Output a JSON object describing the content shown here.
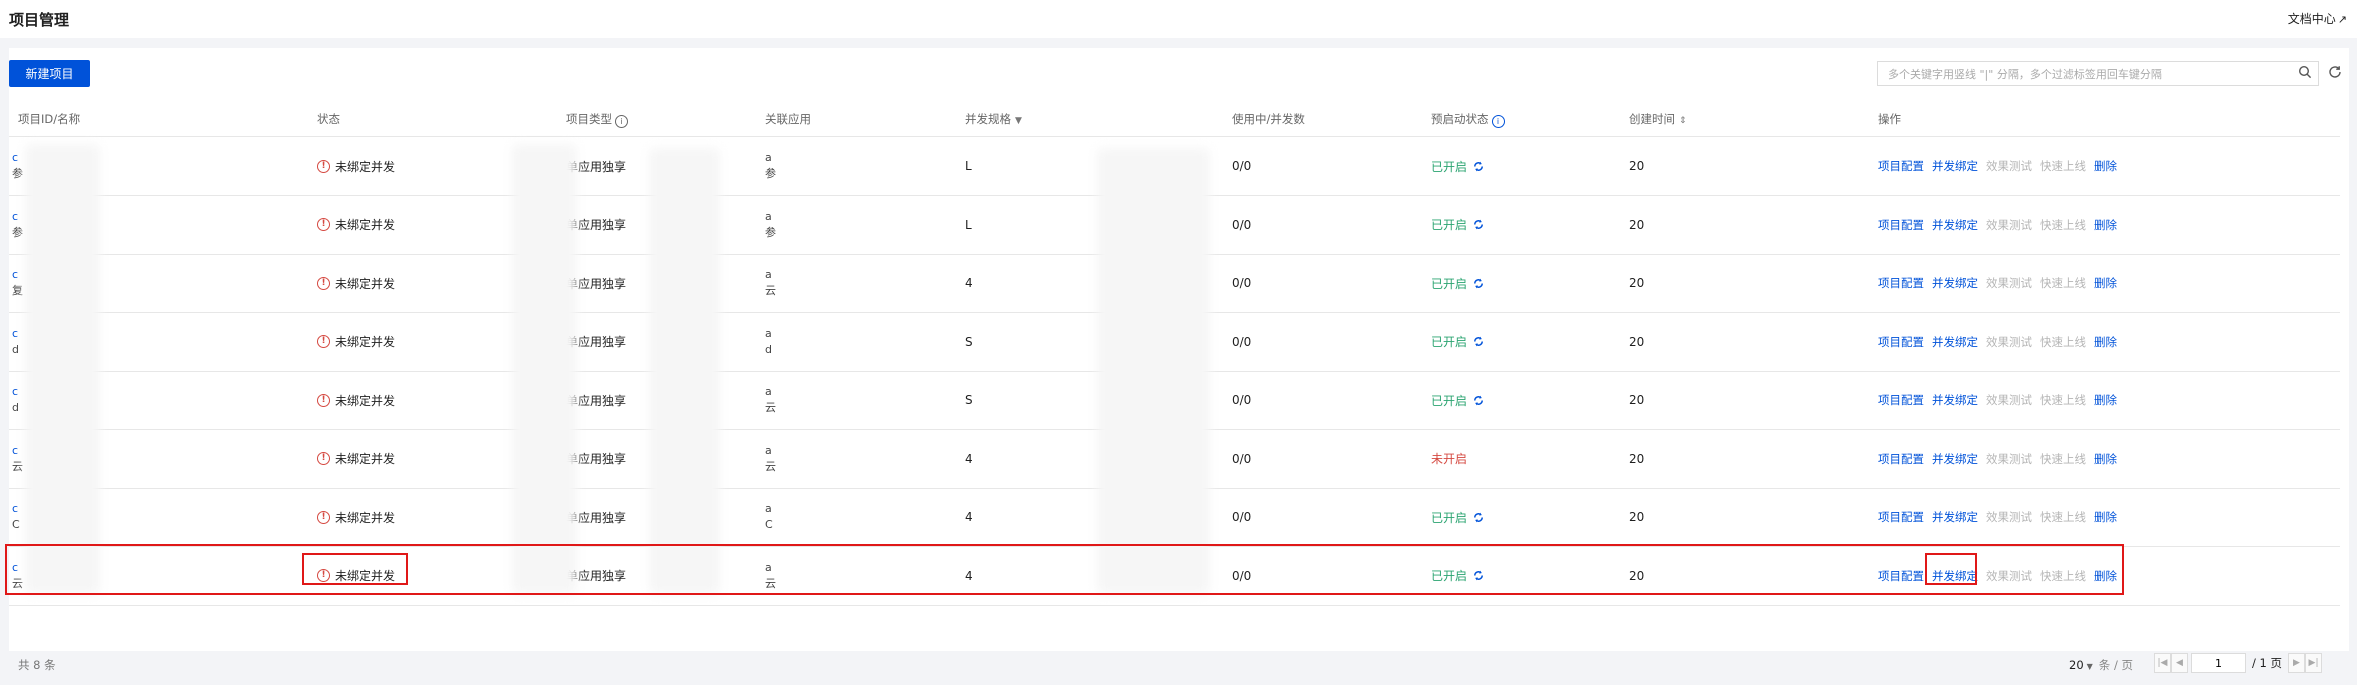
{
  "header": {
    "title": "项目管理",
    "doc_link": "文档中心"
  },
  "toolbar": {
    "new_button": "新建项目",
    "search_placeholder": "多个关键字用竖线 \"|\" 分隔，多个过滤标签用回车键分隔"
  },
  "columns": [
    "项目ID/名称",
    "状态",
    "项目类型",
    "关联应用",
    "并发规格",
    "使用中/并发数",
    "预启动状态",
    "创建时间",
    "操作"
  ],
  "rows": [
    {
      "id": "c",
      "name": "参",
      "status": "未绑定并发",
      "type": "单应用独享",
      "app1": "a",
      "app2": "参",
      "spec": "L",
      "usage": "0/0",
      "prestart": "已开启",
      "prestart_on": true,
      "created": "20"
    },
    {
      "id": "c",
      "name": "参",
      "status": "未绑定并发",
      "type": "单应用独享",
      "app1": "a",
      "app2": "参",
      "spec": "L",
      "usage": "0/0",
      "prestart": "已开启",
      "prestart_on": true,
      "created": "20"
    },
    {
      "id": "c",
      "name": "复",
      "status": "未绑定并发",
      "type": "单应用独享",
      "app1": "a",
      "app2": "云",
      "spec": "4",
      "usage": "0/0",
      "prestart": "已开启",
      "prestart_on": true,
      "created": "20"
    },
    {
      "id": "c",
      "name": "d",
      "status": "未绑定并发",
      "type": "单应用独享",
      "app1": "a",
      "app2": "d",
      "spec": "S",
      "usage": "0/0",
      "prestart": "已开启",
      "prestart_on": true,
      "created": "20"
    },
    {
      "id": "c",
      "name": "d",
      "status": "未绑定并发",
      "type": "单应用独享",
      "app1": "a",
      "app2": "云",
      "spec": "S",
      "usage": "0/0",
      "prestart": "已开启",
      "prestart_on": true,
      "created": "20"
    },
    {
      "id": "c",
      "name": "云",
      "status": "未绑定并发",
      "type": "单应用独享",
      "app1": "a",
      "app2": "云",
      "spec": "4",
      "usage": "0/0",
      "prestart": "未开启",
      "prestart_on": false,
      "created": "20"
    },
    {
      "id": "c",
      "name": "C",
      "status": "未绑定并发",
      "type": "单应用独享",
      "app1": "a",
      "app2": "C",
      "spec": "4",
      "usage": "0/0",
      "prestart": "已开启",
      "prestart_on": true,
      "created": "20"
    },
    {
      "id": "c",
      "name": "云",
      "status": "未绑定并发",
      "type": "单应用独享",
      "app1": "a",
      "app2": "云",
      "spec": "4",
      "usage": "0/0",
      "prestart": "已开启",
      "prestart_on": true,
      "created": "20"
    }
  ],
  "actions": {
    "config": "项目配置",
    "bind": "并发绑定",
    "test": "效果测试",
    "launch": "快速上线",
    "delete": "删除"
  },
  "footer": {
    "total": "共 8 条",
    "page_size": "20",
    "page_size_unit": "条 / 页",
    "current_page": "1",
    "total_pages": "/ 1 页"
  }
}
